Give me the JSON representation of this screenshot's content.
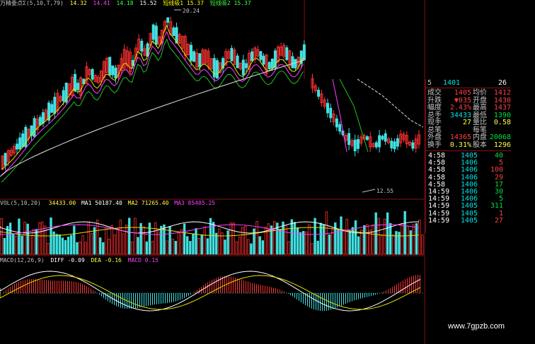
{
  "indicator_header": {
    "name": "万精委点Σ(5,10,T,79)",
    "v1": "14.32",
    "v2": "14.41",
    "v3": "14.18",
    "v4": "15.52",
    "label_a": "短线吸1",
    "val_a": "15.37",
    "label_b": "短线吸2",
    "val_b": "15.37"
  },
  "price_marks": {
    "high_label": "20.24",
    "low_label": "12.55"
  },
  "vol_header": {
    "prefix": "VOL(5,10,20)",
    "vol": "34433.00",
    "ma1_label": "MA1",
    "ma1": "50187.40",
    "ma2_label": "MA2",
    "ma2": "71265.40",
    "ma3_label": "MA3",
    "ma3": "85405.25"
  },
  "macd_header": {
    "prefix": "MACD(12,26,9)",
    "diff_label": "DIFF",
    "diff": "-0.09",
    "dea_label": "DEA",
    "dea": "-0.16",
    "macd_label": "MACD",
    "macd": "0.15"
  },
  "quote_panel": {
    "top_row": {
      "a": "5",
      "b": "1401",
      "c": "26"
    },
    "rows": [
      {
        "l1": "成交",
        "v1": "1405",
        "l2": "均价",
        "v2": "1412"
      },
      {
        "l1": "升跌",
        "v1": "▼035",
        "l2": "开盘",
        "v2": "1430"
      },
      {
        "l1": "幅度",
        "v1": "2.43%",
        "l2": "最高",
        "v2": "1437"
      },
      {
        "l1": "总手",
        "v1": "34433",
        "l2": "最低",
        "v2": "1390"
      },
      {
        "l1": "现手",
        "v1": "27",
        "l2": "量比",
        "v2": "0.58"
      },
      {
        "l1": "总笔",
        "v1": "",
        "l2": "每笔",
        "v2": ""
      },
      {
        "l1": "外盘",
        "v1": "14365",
        "l2": "内盘",
        "v2": "20068"
      },
      {
        "l1": "换手",
        "v1": "0.31%",
        "l2": "股本",
        "v2": "1296"
      }
    ]
  },
  "ticks": [
    {
      "time": "4:58",
      "price": "1405",
      "vol": "40",
      "color": "#00e040"
    },
    {
      "time": "4:58",
      "price": "1406",
      "vol": "5",
      "color": "#ff4040"
    },
    {
      "time": "4:58",
      "price": "1406",
      "vol": "100",
      "color": "#ff4040"
    },
    {
      "time": "4:58",
      "price": "1406",
      "vol": "29",
      "color": "#ff4040"
    },
    {
      "time": "4:58",
      "price": "1406",
      "vol": "17",
      "color": "#00e040"
    },
    {
      "time": "14:59",
      "price": "1406",
      "vol": "30",
      "color": "#00e040"
    },
    {
      "time": "14:59",
      "price": "1406",
      "vol": "5",
      "color": "#00e040"
    },
    {
      "time": "14:59",
      "price": "1405",
      "vol": "311",
      "color": "#00e040"
    },
    {
      "time": "14:59",
      "price": "1405",
      "vol": "1",
      "color": "#ff4040"
    },
    {
      "time": "14:59",
      "price": "1405",
      "vol": "27",
      "color": "#ff4040"
    }
  ],
  "watermark": "www.7gpzb.com",
  "colors": {
    "up": "#ff3030",
    "down": "#40e0e0",
    "ma_white": "#e0e0e0",
    "ma_yellow": "#e8e000",
    "ma_magenta": "#ff40ff",
    "ma_green": "#20c020",
    "grid": "#8a1010"
  }
}
